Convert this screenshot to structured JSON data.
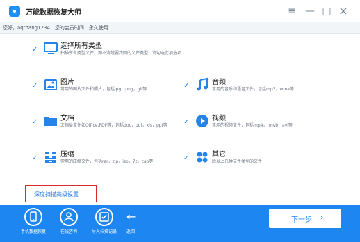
{
  "app": {
    "title": "万能数据恢复大师",
    "window_controls": {
      "menu_icon": "menu-icon",
      "minimize_icon": "minimize-icon",
      "maximize_icon": "maximize-icon",
      "close_icon": "close-icon"
    }
  },
  "user_bar": {
    "text": "您好，aqthang1234！您的会员时间：永久使用"
  },
  "options": [
    {
      "label": "选择所有类型",
      "description": "扫描所有类型文件，如不清楚要找回的文件类型，请勾选此项选项",
      "icon": "monitor-icon",
      "checked": true
    },
    {
      "label": "图片",
      "description": "常用的图片文件和照片，包括jpg，png，gif等",
      "icon": "image-icon",
      "checked": true
    },
    {
      "label": "音频",
      "description": "常用的音乐和语音文件，包括mp3，wma等",
      "icon": "music-icon",
      "checked": true
    },
    {
      "label": "文档",
      "description": "文档类文件如Office,PDF等，包括doc，pdf，xls，ppt等",
      "icon": "folder-icon",
      "checked": true
    },
    {
      "label": "视频",
      "description": "常用的视频文件，包括mp4，rmvb，avi等",
      "icon": "play-icon",
      "checked": true
    },
    {
      "label": "压缩",
      "description": "常用的压缩文件，包括rar，zip，iso，7z，cab等",
      "icon": "archive-icon",
      "checked": true
    },
    {
      "label": "其它",
      "description": "除以上几种文件类型的文件",
      "icon": "apps-icon",
      "checked": true
    }
  ],
  "advanced_link": "深度扫描高级设置",
  "bottom_bar": {
    "items": [
      {
        "label": "手机数据恢复",
        "icon": "phone-icon"
      },
      {
        "label": "在线咨询",
        "icon": "support-icon"
      },
      {
        "label": "导入扫描记录",
        "icon": "import-icon"
      }
    ],
    "back_label": "返回",
    "next_label": "下一步"
  },
  "colors": {
    "accent": "#1d86f0",
    "check": "#2583e9",
    "highlight_border": "#d92b2b"
  }
}
